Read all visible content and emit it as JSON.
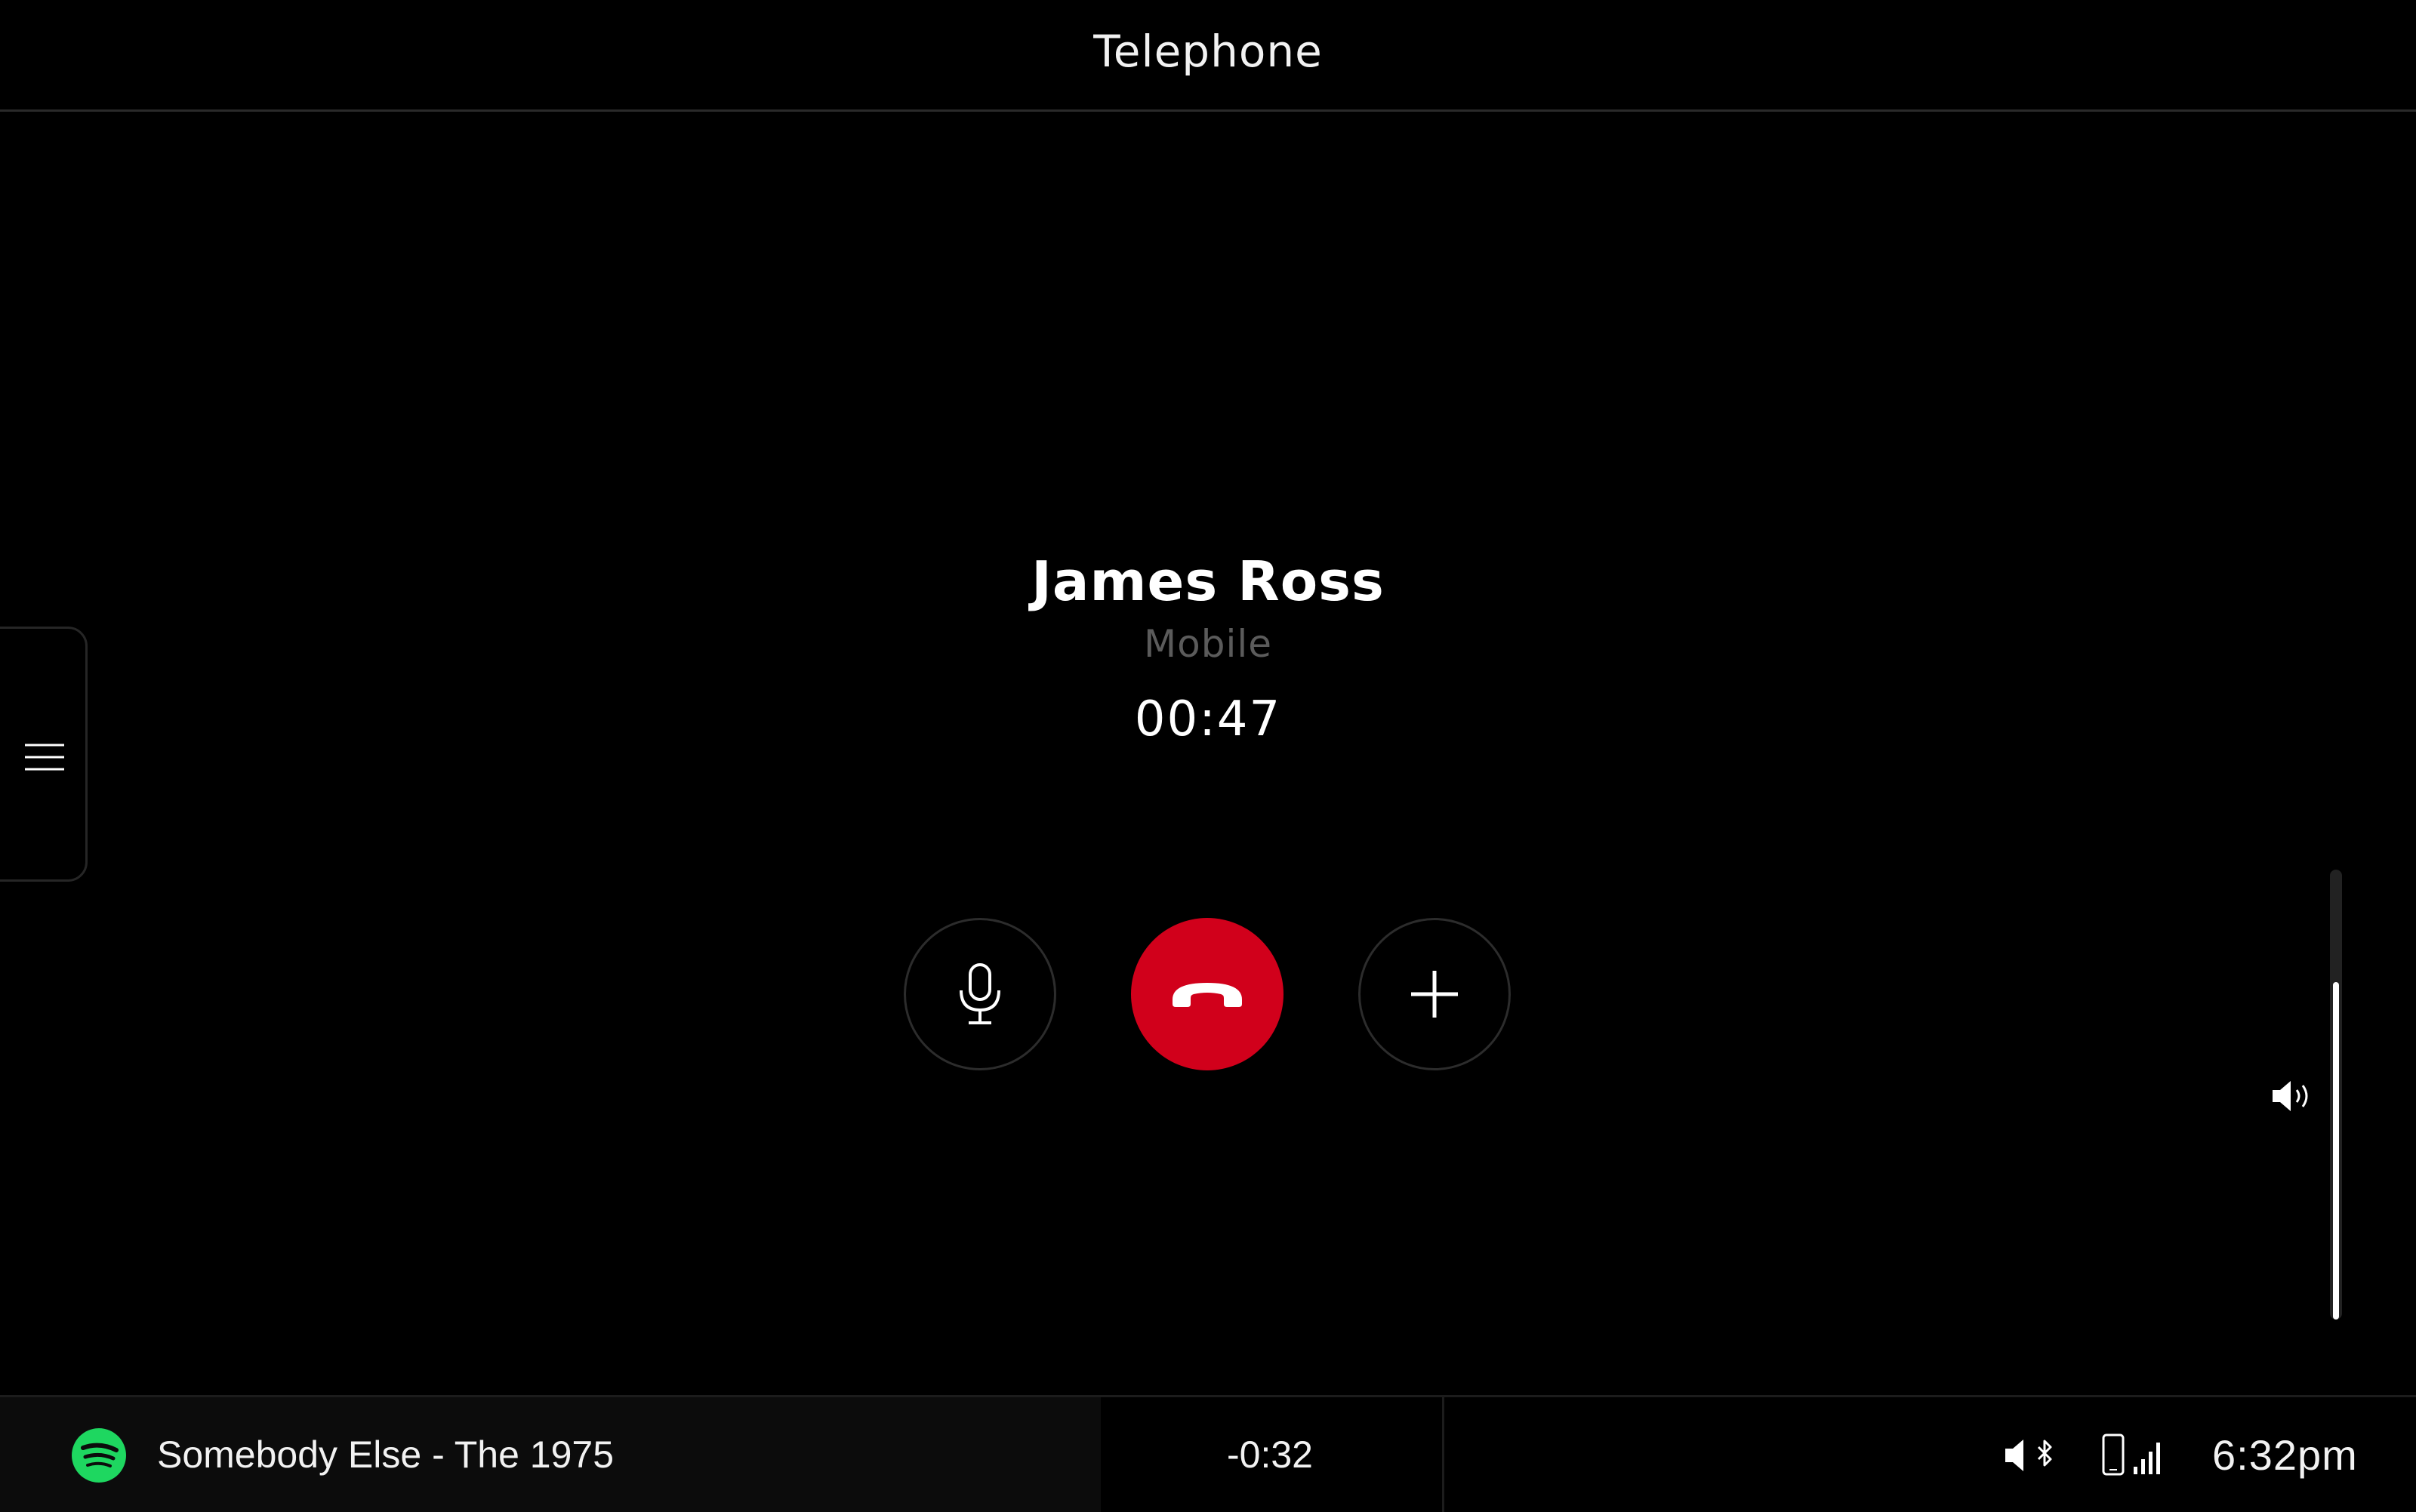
{
  "header": {
    "title": "Telephone"
  },
  "side_menu": {
    "icon": "menu-icon"
  },
  "call": {
    "caller_name": "James Ross",
    "number_type": "Mobile",
    "duration": "00:47",
    "controls": {
      "mute_icon": "microphone-icon",
      "end_icon": "end-call-icon",
      "add_icon": "plus-icon"
    },
    "end_color": "#d1001b"
  },
  "volume": {
    "icon": "speaker-icon",
    "level": 0.75
  },
  "media": {
    "source_icon": "spotify-icon",
    "source_color": "#1ed760",
    "track": "Somebody Else - The 1975",
    "remaining": "-0:32"
  },
  "status": {
    "icons": [
      "speaker-muted-icon",
      "bluetooth-icon",
      "phone-icon",
      "signal-icon"
    ],
    "time": "6:32pm"
  }
}
